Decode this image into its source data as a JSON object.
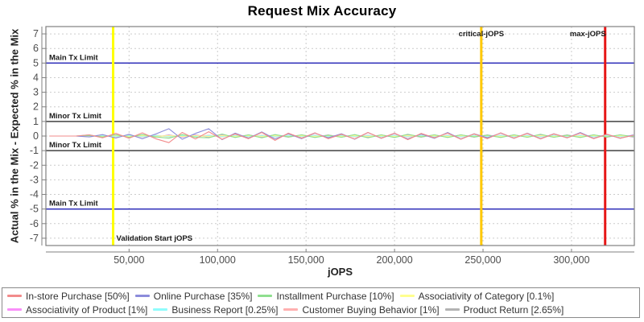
{
  "chart_data": {
    "type": "line",
    "title": "Request Mix Accuracy",
    "xlabel": "jOPS",
    "ylabel": "Actual % in the Mix - Expected % in the Mix",
    "xlim": [
      3000,
      335500
    ],
    "ylim": [
      -7.5,
      7.5
    ],
    "x_ticks": [
      50000,
      100000,
      150000,
      200000,
      250000,
      300000
    ],
    "y_ticks": [
      7,
      6,
      5,
      4,
      3,
      2,
      1,
      0,
      -1,
      -2,
      -3,
      -4,
      -5,
      -6,
      -7
    ],
    "grid": "dashed",
    "grid_color": "#cccccc",
    "axis_color": "#808080",
    "tick_label_color": "#4d4d4d",
    "legend_position": "bottom",
    "limit_lines": [
      {
        "y": 5,
        "label": "Main Tx Limit",
        "color": "#1f1fb4",
        "width": 1.4
      },
      {
        "y": 1,
        "label": "Minor Tx Limit",
        "color": "#5c5c5c",
        "width": 1.8
      },
      {
        "y": -1,
        "label": "Minor Tx Limit",
        "color": "#5c5c5c",
        "width": 1.8
      },
      {
        "y": -5,
        "label": "Main Tx Limit",
        "color": "#1f1fb4",
        "width": 1.4
      }
    ],
    "markers": [
      {
        "x": 41000,
        "label": "Validation Start jOPS",
        "color": "#ffff00",
        "width": 3,
        "label_pos": "bottom-right"
      },
      {
        "x": 249000,
        "label": "critical-jOPS",
        "color": "#ffc800",
        "width": 3,
        "label_pos": "top-center"
      },
      {
        "x": 319000,
        "label": "max-jOPS",
        "color": "#e61717",
        "width": 3,
        "label_pos": "top-left"
      }
    ],
    "x": [
      5000,
      12500,
      20000,
      27500,
      35000,
      42500,
      50000,
      57500,
      65000,
      72500,
      80000,
      87500,
      95000,
      102500,
      110000,
      117500,
      125000,
      132500,
      140000,
      147500,
      155000,
      162500,
      170000,
      177500,
      185000,
      192500,
      200000,
      207500,
      215000,
      222500,
      230000,
      237500,
      245000,
      252500,
      260000,
      267500,
      275000,
      282500,
      290000,
      297500,
      305000,
      312500,
      320000,
      327500,
      335000
    ],
    "series": [
      {
        "name": "In-store Purchase [50%]",
        "color": "#f28b8b",
        "y": [
          0,
          0,
          0,
          0.08,
          -0.12,
          0.18,
          -0.15,
          0.22,
          -0.18,
          -0.45,
          0.25,
          -0.2,
          0.3,
          -0.22,
          0.15,
          -0.18,
          0.25,
          -0.3,
          0.2,
          -0.15,
          0.22,
          -0.18,
          0.12,
          -0.2,
          0.25,
          -0.15,
          0.2,
          -0.25,
          0.18,
          -0.12,
          0.2,
          -0.22,
          0.15,
          -0.18,
          0.22,
          -0.15,
          0.18,
          -0.2,
          0.15,
          -0.12,
          0.2,
          -0.18,
          0.12,
          -0.15,
          0.05
        ]
      },
      {
        "name": "Online Purchase [35%]",
        "color": "#8c8cdb",
        "y": [
          0,
          0,
          0,
          -0.06,
          0.1,
          -0.14,
          0.12,
          -0.18,
          0.14,
          0.5,
          -0.22,
          0.18,
          0.5,
          -0.25,
          0.2,
          -0.15,
          0.28,
          -0.2,
          0.16,
          -0.18,
          0.2,
          -0.12,
          0.16,
          -0.22,
          0.24,
          -0.16,
          0.18,
          -0.2,
          0.14,
          -0.16,
          0.24,
          -0.2,
          0.16,
          -0.12,
          0.2,
          -0.16,
          0.2,
          -0.18,
          0.16,
          -0.12,
          0.24,
          -0.16,
          0.12,
          -0.16,
          0.08
        ]
      },
      {
        "name": "Installment Purchase [10%]",
        "color": "#8fdf8f",
        "y": [
          0,
          0,
          0,
          0.04,
          -0.06,
          0.08,
          -0.08,
          0.1,
          -0.06,
          -0.15,
          0.1,
          -0.08,
          -0.12,
          0.14,
          -0.1,
          0.08,
          -0.12,
          0.1,
          -0.06,
          0.08,
          -0.1,
          0.06,
          -0.08,
          0.1,
          -0.12,
          0.08,
          -0.1,
          0.12,
          -0.06,
          0.08,
          -0.1,
          0.08,
          -0.06,
          0.06,
          -0.1,
          0.08,
          -0.08,
          0.12,
          -0.08,
          0.06,
          -0.1,
          0.08,
          -0.06,
          0.08,
          -0.04
        ]
      },
      {
        "name": "Associativity of Category [0.1%]",
        "color": "#ffff8f",
        "y": [
          0,
          0,
          0,
          0.02,
          -0.02,
          0.02,
          -0.02,
          0.02,
          -0.02,
          0.02,
          -0.02,
          0.02,
          -0.02,
          0.02,
          -0.02,
          0.02,
          -0.02,
          0.02,
          -0.02,
          0.02,
          -0.02,
          0.02,
          -0.02,
          0.02,
          -0.02,
          0.02,
          -0.02,
          0.02,
          -0.02,
          0.02,
          -0.02,
          0.02,
          -0.02,
          0.02,
          -0.02,
          0.02,
          -0.02,
          0.02,
          -0.02,
          0.02,
          -0.02,
          0.02,
          -0.02,
          0.02,
          -0.02
        ]
      },
      {
        "name": "Associativity of Product [1%]",
        "color": "#f98ff9",
        "y": [
          0,
          0,
          0,
          0.05,
          -0.05,
          0.05,
          -0.05,
          0.05,
          -0.05,
          0.05,
          -0.05,
          0.05,
          -0.05,
          0.05,
          -0.05,
          0.05,
          -0.05,
          0.05,
          -0.05,
          0.05,
          -0.05,
          0.05,
          -0.05,
          0.05,
          -0.05,
          0.05,
          -0.05,
          0.05,
          -0.05,
          0.05,
          -0.05,
          0.05,
          -0.05,
          0.05,
          -0.05,
          0.05,
          -0.05,
          0.05,
          -0.05,
          0.05,
          -0.05,
          0.05,
          -0.05,
          0.05,
          -0.05
        ]
      },
      {
        "name": "Business Report [0.25%]",
        "color": "#8ffcfc",
        "y": [
          0,
          0,
          0,
          -0.04,
          0.04,
          -0.04,
          0.04,
          -0.04,
          0.04,
          -0.04,
          0.04,
          -0.04,
          0.04,
          -0.04,
          0.04,
          -0.04,
          0.04,
          -0.04,
          0.04,
          -0.04,
          0.04,
          -0.04,
          0.04,
          -0.04,
          0.04,
          -0.04,
          0.04,
          -0.04,
          0.04,
          -0.04,
          0.04,
          -0.04,
          0.04,
          -0.04,
          0.04,
          -0.04,
          0.04,
          -0.04,
          0.04,
          -0.04,
          0.04,
          -0.04,
          0.04,
          -0.04,
          0.04
        ]
      },
      {
        "name": "Customer Buying Behavior [1%]",
        "color": "#ffb0b0",
        "y": [
          0,
          0,
          0,
          -0.06,
          0.06,
          -0.06,
          0.06,
          -0.06,
          0.06,
          -0.06,
          0.06,
          -0.06,
          0.06,
          -0.06,
          0.06,
          -0.06,
          0.06,
          -0.06,
          0.06,
          -0.06,
          0.06,
          -0.06,
          0.06,
          -0.06,
          0.06,
          -0.06,
          0.06,
          -0.06,
          0.06,
          -0.06,
          0.06,
          -0.06,
          0.06,
          -0.06,
          0.06,
          -0.06,
          0.06,
          -0.06,
          0.06,
          -0.06,
          0.06,
          -0.06,
          0.06,
          -0.06,
          0.06
        ]
      },
      {
        "name": "Product Return [2.65%]",
        "color": "#b3b3b3",
        "y": [
          0,
          0,
          0,
          0.08,
          -0.08,
          0.08,
          -0.08,
          0.08,
          -0.08,
          0.08,
          -0.08,
          0.08,
          -0.08,
          0.08,
          -0.08,
          0.08,
          -0.08,
          0.08,
          -0.08,
          0.08,
          -0.08,
          0.08,
          -0.08,
          0.08,
          -0.08,
          0.08,
          -0.08,
          0.08,
          -0.08,
          0.08,
          -0.08,
          0.08,
          -0.08,
          0.08,
          -0.08,
          0.08,
          -0.08,
          0.08,
          -0.08,
          0.08,
          -0.08,
          0.08,
          -0.08,
          0.08,
          -0.08
        ]
      }
    ]
  }
}
